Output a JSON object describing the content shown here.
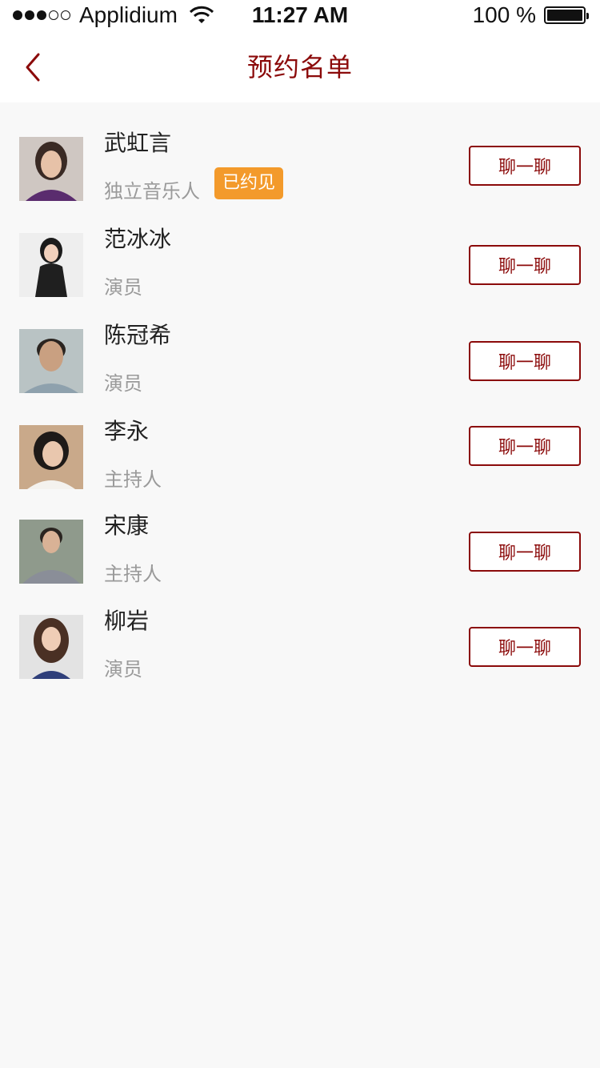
{
  "status_bar": {
    "carrier": "Applidium",
    "time": "11:27 AM",
    "battery": "100 %",
    "signal_dots_filled": 3,
    "signal_dots_total": 5,
    "battery_level": 1.0
  },
  "nav": {
    "title": "预约名单",
    "back_icon": "chevron-left-icon"
  },
  "colors": {
    "accent": "#8b0a0a",
    "badge": "#f39a2b",
    "background": "#f8f8f8"
  },
  "contacts": [
    {
      "name": "武虹言",
      "role": "独立音乐人",
      "badge": "已约见",
      "chat_label": "聊一聊"
    },
    {
      "name": "范冰冰",
      "role": "演员",
      "chat_label": "聊一聊"
    },
    {
      "name": "陈冠希",
      "role": "演员",
      "chat_label": "聊一聊"
    },
    {
      "name": "李永",
      "role": "主持人",
      "chat_label": "聊一聊"
    },
    {
      "name": "宋康",
      "role": "主持人",
      "chat_label": "聊一聊"
    },
    {
      "name": "柳岩",
      "role": "演员",
      "chat_label": "聊一聊"
    }
  ]
}
